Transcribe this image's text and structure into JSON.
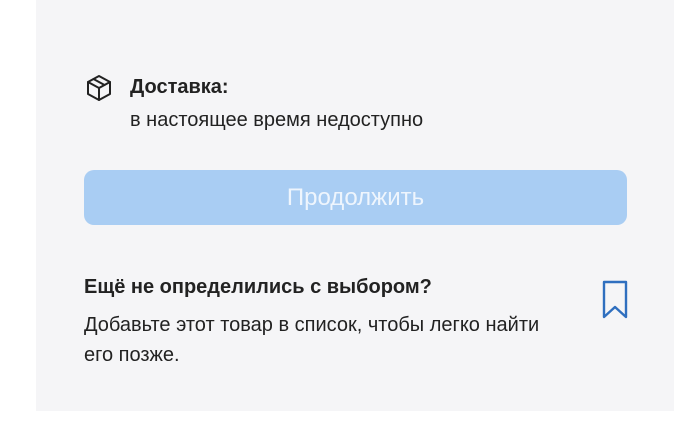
{
  "delivery": {
    "icon": "package-box-icon",
    "title": "Доставка:",
    "status": "в настоящее время недоступно"
  },
  "continue_button": {
    "label": "Продолжить",
    "state": "disabled",
    "color": "#a9cdf3"
  },
  "wishlist": {
    "title": "Ещё не определились с выбором?",
    "text": "Добавьте этот товар в список, чтобы легко найти его позже.",
    "icon": "bookmark-icon",
    "accent_color": "#2f6fbf"
  }
}
